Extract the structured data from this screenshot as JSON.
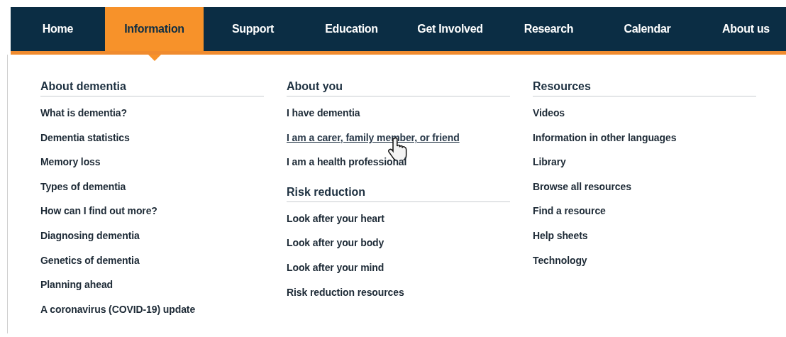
{
  "nav": [
    {
      "label": "Home",
      "selected": false
    },
    {
      "label": "Information",
      "selected": true
    },
    {
      "label": "Support",
      "selected": false
    },
    {
      "label": "Education",
      "selected": false
    },
    {
      "label": "Get Involved",
      "selected": false
    },
    {
      "label": "Research",
      "selected": false
    },
    {
      "label": "Calendar",
      "selected": false
    },
    {
      "label": "About us",
      "selected": false
    }
  ],
  "columns": [
    {
      "sections": [
        {
          "heading": "About dementia",
          "links": [
            {
              "label": "What is dementia?",
              "hovered": false
            },
            {
              "label": "Dementia statistics",
              "hovered": false
            },
            {
              "label": "Memory loss",
              "hovered": false
            },
            {
              "label": "Types of dementia",
              "hovered": false
            },
            {
              "label": "How can I find out more?",
              "hovered": false
            },
            {
              "label": "Diagnosing dementia",
              "hovered": false
            },
            {
              "label": "Genetics of dementia",
              "hovered": false
            },
            {
              "label": "Planning ahead",
              "hovered": false
            },
            {
              "label": "A coronavirus (COVID-19) update",
              "hovered": false
            }
          ]
        }
      ]
    },
    {
      "sections": [
        {
          "heading": "About you",
          "links": [
            {
              "label": "I have dementia",
              "hovered": false
            },
            {
              "label": "I am a carer, family member, or friend",
              "hovered": true
            },
            {
              "label": "I am a health professional",
              "hovered": false
            }
          ]
        },
        {
          "heading": "Risk reduction",
          "links": [
            {
              "label": "Look after your heart",
              "hovered": false
            },
            {
              "label": "Look after your body",
              "hovered": false
            },
            {
              "label": "Look after your mind",
              "hovered": false
            },
            {
              "label": "Risk reduction resources",
              "hovered": false
            }
          ]
        }
      ]
    },
    {
      "sections": [
        {
          "heading": "Resources",
          "links": [
            {
              "label": "Videos",
              "hovered": false
            },
            {
              "label": "Information in other languages",
              "hovered": false
            },
            {
              "label": "Library",
              "hovered": false
            },
            {
              "label": "Browse all resources",
              "hovered": false
            },
            {
              "label": "Find a resource",
              "hovered": false
            },
            {
              "label": "Help sheets",
              "hovered": false
            },
            {
              "label": "Technology",
              "hovered": false
            }
          ]
        }
      ]
    }
  ]
}
